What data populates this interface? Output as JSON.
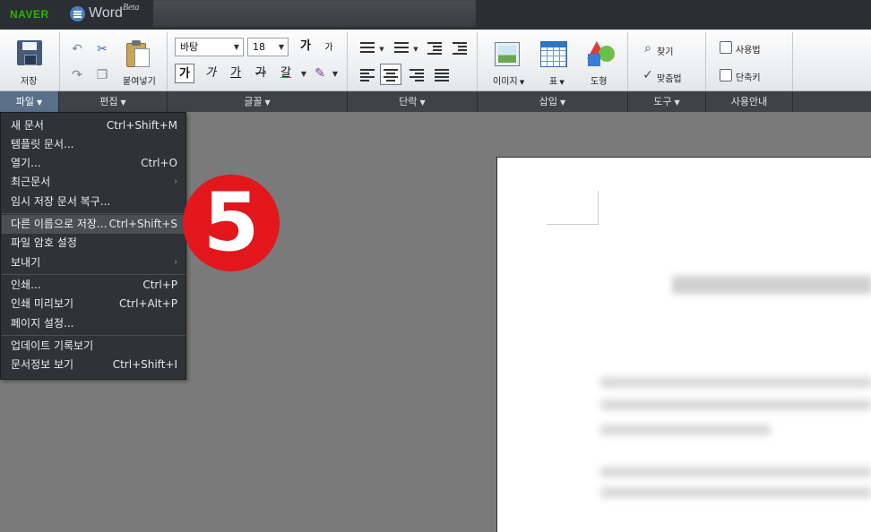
{
  "titlebar": {
    "brand": "NAVER",
    "app_name": "Word",
    "app_tag": "Beta"
  },
  "ribbon": {
    "file": {
      "save_label": "저장"
    },
    "edit": {
      "paste_label": "붙여넣기"
    },
    "font": {
      "face": "바탕",
      "size": "18",
      "grow": "가",
      "shrink": "가",
      "bold": "가",
      "italic": "가",
      "underline": "가",
      "strike": "가",
      "color": "갈"
    },
    "insert": {
      "image_label": "이미지",
      "table_label": "표",
      "shape_label": "도형"
    },
    "tools": {
      "find_label": "찾기",
      "spell_label": "맞춤법"
    },
    "help": {
      "usage_label": "사용법",
      "shortcut_label": "단축키"
    }
  },
  "tabs": [
    {
      "label": "파일"
    },
    {
      "label": "편집"
    },
    {
      "label": "글꼴"
    },
    {
      "label": "단락"
    },
    {
      "label": "삽입"
    },
    {
      "label": "도구"
    },
    {
      "label": "사용안내"
    }
  ],
  "menu": {
    "items": [
      {
        "label": "새 문서",
        "shortcut": "Ctrl+Shift+M"
      },
      {
        "label": "템플릿 문서...",
        "shortcut": ""
      },
      {
        "label": "열기...",
        "shortcut": "Ctrl+O"
      },
      {
        "label": "최근문서",
        "shortcut": ""
      },
      {
        "label": "임시 저장 문서 복구...",
        "shortcut": ""
      },
      {
        "label": "다른 이름으로 저장...",
        "shortcut": "Ctrl+Shift+S"
      },
      {
        "label": "파일 암호 설정",
        "shortcut": ""
      },
      {
        "label": "보내기",
        "shortcut": ""
      },
      {
        "label": "인쇄...",
        "shortcut": "Ctrl+P"
      },
      {
        "label": "인쇄 미리보기",
        "shortcut": "Ctrl+Alt+P"
      },
      {
        "label": "페이지 설정...",
        "shortcut": ""
      },
      {
        "label": "업데이트 기록보기",
        "shortcut": ""
      },
      {
        "label": "문서정보 보기",
        "shortcut": "Ctrl+Shift+I"
      }
    ]
  },
  "step_badge": "5",
  "colors": {
    "badge": "#e3161b",
    "menu_bg": "#2f3337",
    "tab_active": "#5a6f8a"
  }
}
